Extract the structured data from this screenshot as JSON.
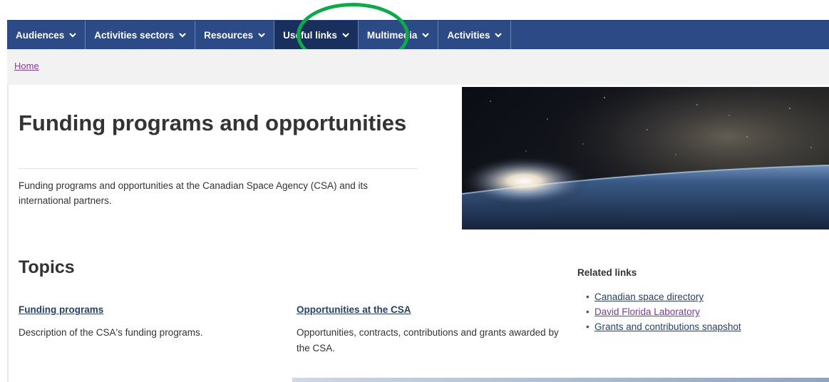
{
  "nav": {
    "items": [
      {
        "label": "Audiences",
        "active": false
      },
      {
        "label": "Activities sectors",
        "active": false
      },
      {
        "label": "Resources",
        "active": false
      },
      {
        "label": "Useful links",
        "active": true
      },
      {
        "label": "Multimedia",
        "active": false
      },
      {
        "label": "Activities",
        "active": false
      }
    ]
  },
  "breadcrumb": {
    "home": "Home"
  },
  "page": {
    "title": "Funding programs and opportunities",
    "lead": "Funding programs and opportunities at the Canadian Space Agency (CSA) and its international partners."
  },
  "topics": {
    "heading": "Topics",
    "items": [
      {
        "title": "Funding programs",
        "description": "Description of the CSA's funding programs."
      },
      {
        "title": "Opportunities at the CSA",
        "description": "Opportunities, contracts, contributions and grants awarded by the CSA."
      }
    ]
  },
  "related": {
    "title": "Related links",
    "links": [
      {
        "label": "Canadian space directory"
      },
      {
        "label": "David Florida Laboratory"
      },
      {
        "label": "Grants and contributions snapshot"
      }
    ]
  },
  "colors": {
    "nav_bg": "#2b4a86",
    "nav_active": "#192f5d",
    "annotation": "#0fa84a",
    "link": "#284162",
    "visited_link": "#7b3a9e"
  }
}
